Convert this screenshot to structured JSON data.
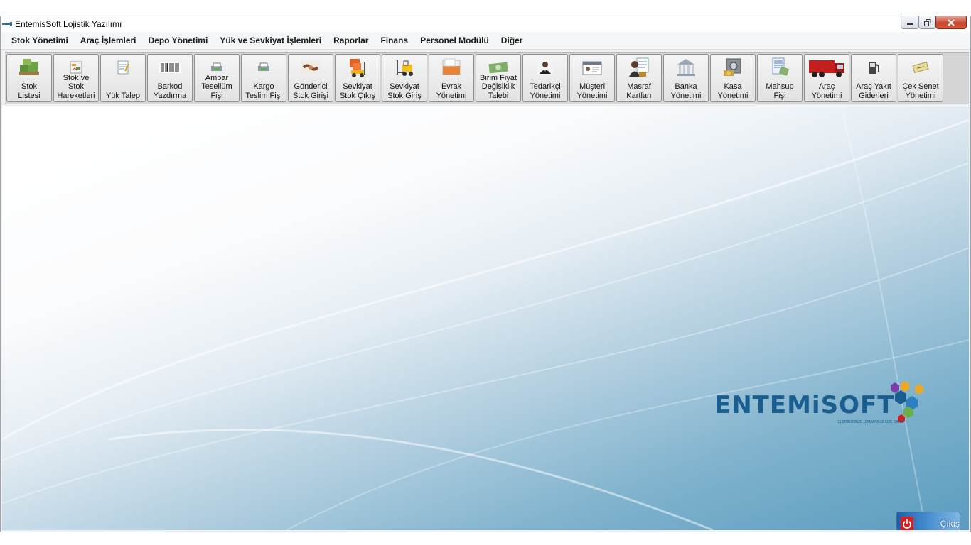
{
  "window": {
    "title": "EntemisSoft Lojistik Yazılımı"
  },
  "menu": [
    "Stok Yönetimi",
    "Araç İşlemleri",
    "Depo Yönetimi",
    "Yük ve Sevkiyat İşlemleri",
    "Raporlar",
    "Finans",
    "Personel Modülü",
    "Diğer"
  ],
  "toolbar": [
    {
      "label": "Stok\nListesi",
      "icon": "boxes-icon"
    },
    {
      "label": "Stok ve\nStok\nHareketleri",
      "icon": "stock-movements-icon"
    },
    {
      "label": "Yük Talep",
      "icon": "request-note-icon"
    },
    {
      "label": "Barkod\nYazdırma",
      "icon": "barcode-icon"
    },
    {
      "label": "Ambar\nTesellüm\nFişi",
      "icon": "printer-icon"
    },
    {
      "label": "Kargo\nTeslim Fişi",
      "icon": "printer-icon"
    },
    {
      "label": "Gönderici\nStok Girişi",
      "icon": "handshake-icon"
    },
    {
      "label": "Sevkiyat\nStok Çıkış",
      "icon": "forklift-boxes-icon"
    },
    {
      "label": "Sevkiyat\nStok Giriş",
      "icon": "forklift-icon"
    },
    {
      "label": "Evrak\nYönetimi",
      "icon": "document-icon"
    },
    {
      "label": "Birim Fiyat\nDeğişiklik\nTalebi",
      "icon": "money-icon"
    },
    {
      "label": "Tedarikçi\nYönetimi",
      "icon": "supplier-icon"
    },
    {
      "label": "Müşteri\nYönetimi",
      "icon": "customer-card-icon"
    },
    {
      "label": "Masraf\nKartları",
      "icon": "expense-card-icon"
    },
    {
      "label": "Banka\nYönetimi",
      "icon": "bank-icon"
    },
    {
      "label": "Kasa\nYönetimi",
      "icon": "safe-icon"
    },
    {
      "label": "Mahsup\nFişi",
      "icon": "voucher-icon"
    },
    {
      "label": "Araç\nYönetimi",
      "icon": "truck-icon"
    },
    {
      "label": "Araç Yakıt\nGiderleri",
      "icon": "fuel-pump-icon"
    },
    {
      "label": "Çek Senet\nYönetimi",
      "icon": "cheque-icon"
    }
  ],
  "logo": {
    "text": "ENTEMiSOFT",
    "tagline": "İŞLERİNİZ BİZE, ZAMANINIZ SİZE KALIR"
  },
  "exit_button": {
    "label": "Çıkış"
  },
  "colors": {
    "logo_blue": "#1a5e8f",
    "exit_blue": "#2a6fb8",
    "close_red": "#c9452e"
  }
}
